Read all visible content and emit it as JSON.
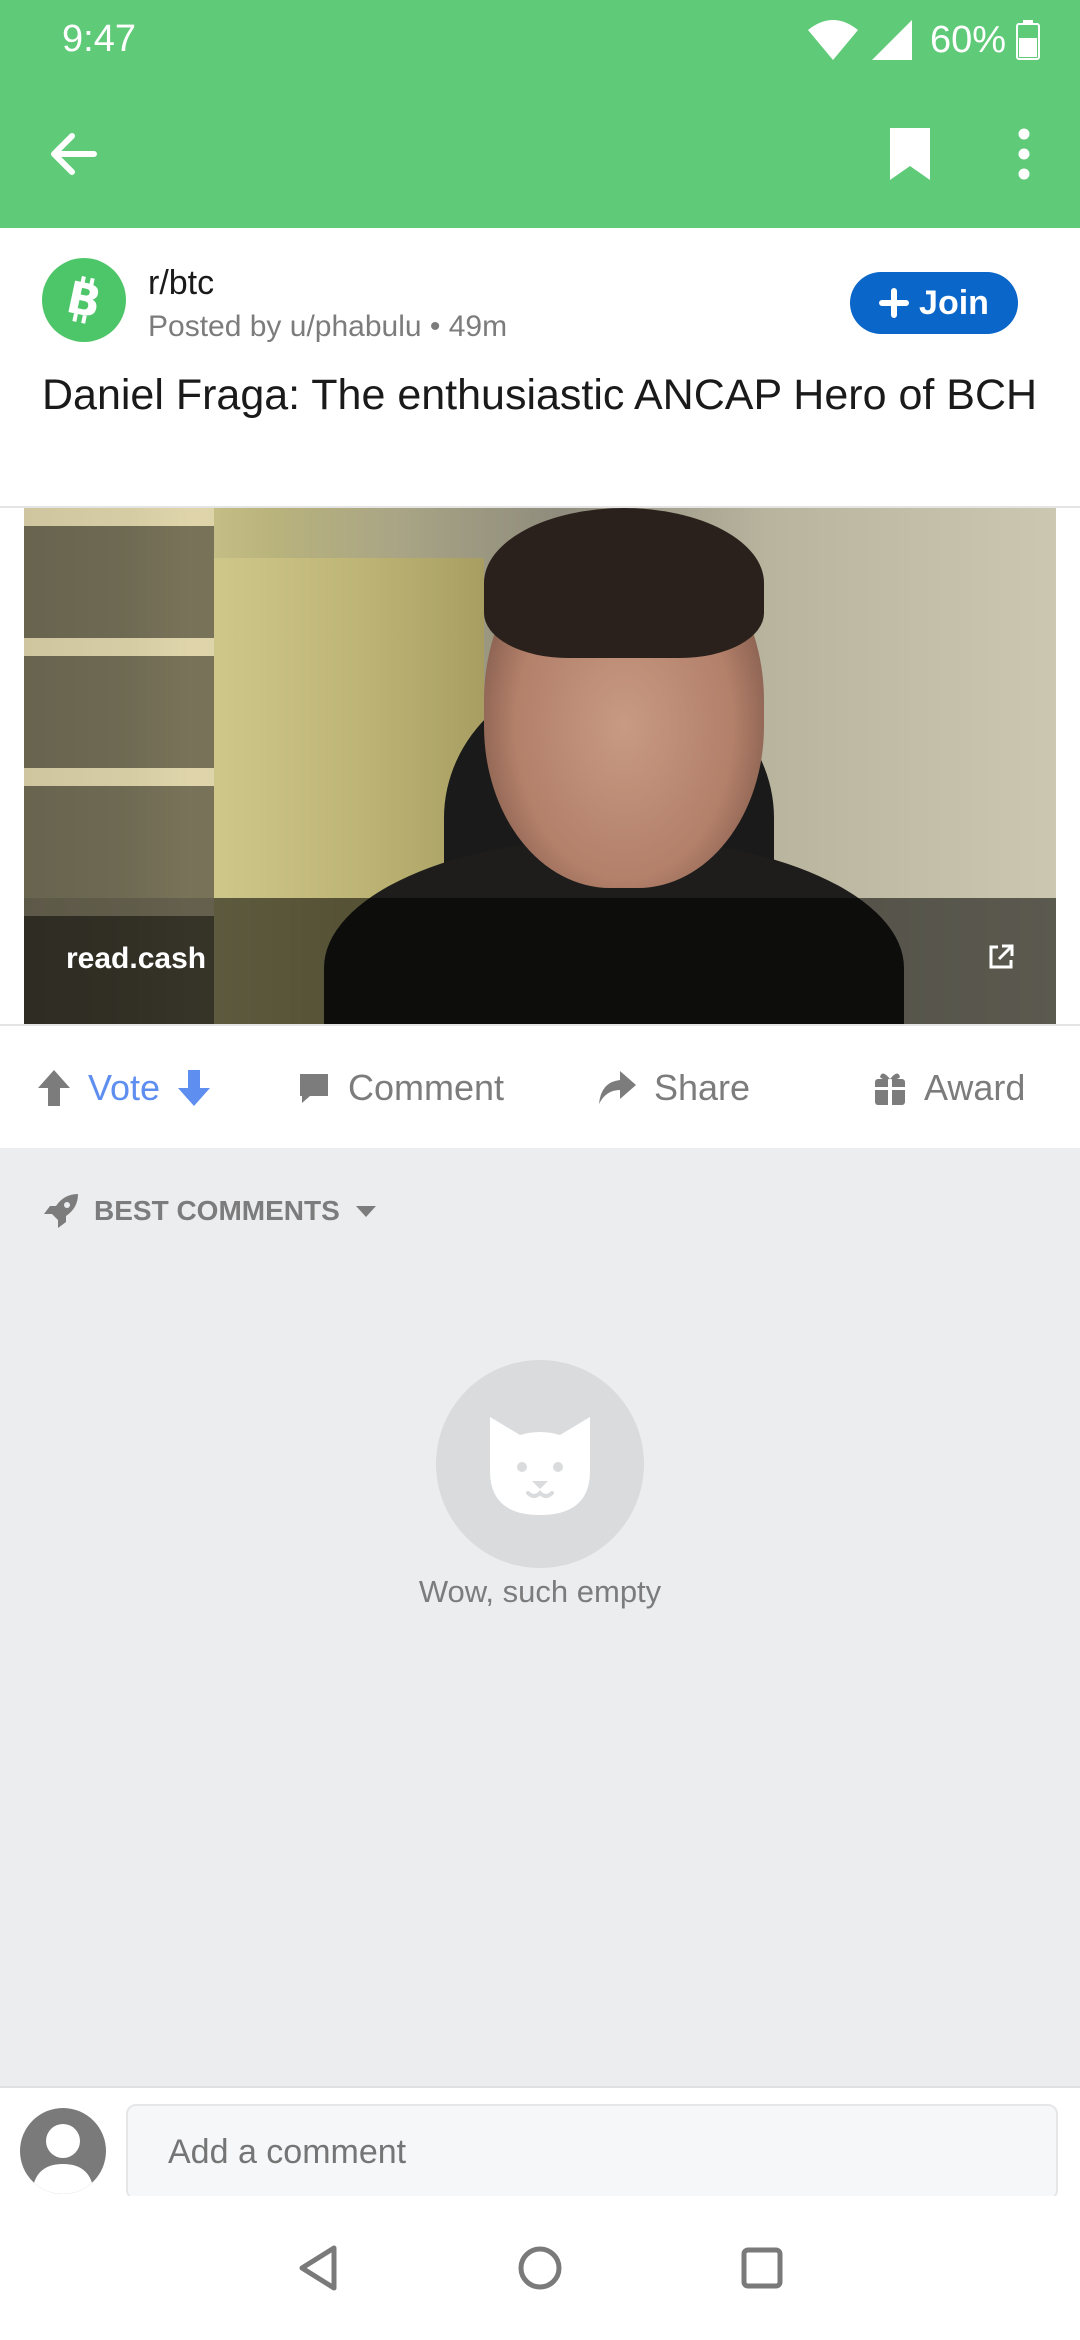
{
  "status_bar": {
    "time": "9:47",
    "battery": "60%"
  },
  "post": {
    "subreddit": "r/btc",
    "posted_by": "Posted by u/phabulu • 49m",
    "join_label": "Join",
    "title": "Daniel Fraga: The enthusiastic ANCAP Hero of BCH",
    "link_domain": "read.cash"
  },
  "actions": {
    "vote_label": "Vote",
    "comment_label": "Comment",
    "share_label": "Share",
    "award_label": "Award"
  },
  "comments": {
    "sort_label": "BEST COMMENTS",
    "empty_text": "Wow, such empty"
  },
  "composer": {
    "placeholder": "Add a comment"
  },
  "colors": {
    "app_bar": "#5FCA77",
    "join_button": "#0A66C8",
    "vote_accent": "#5E8EF0",
    "subreddit_icon": "#4DC569"
  }
}
